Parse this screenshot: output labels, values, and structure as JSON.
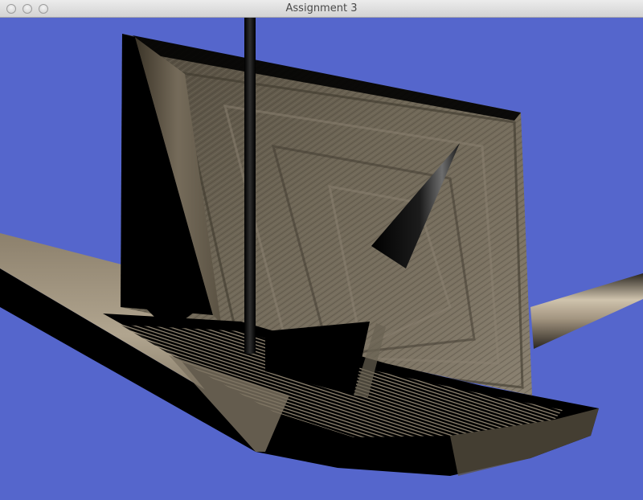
{
  "window": {
    "title": "Assignment 3"
  },
  "window_controls": {
    "close": "close-button",
    "minimize": "minimize-button",
    "zoom": "zoom-button"
  },
  "scene": {
    "background_color": "#5566cc",
    "material_color": "#6e6656",
    "shadow_color": "#000000",
    "highlight_color": "#d8cbb6"
  }
}
